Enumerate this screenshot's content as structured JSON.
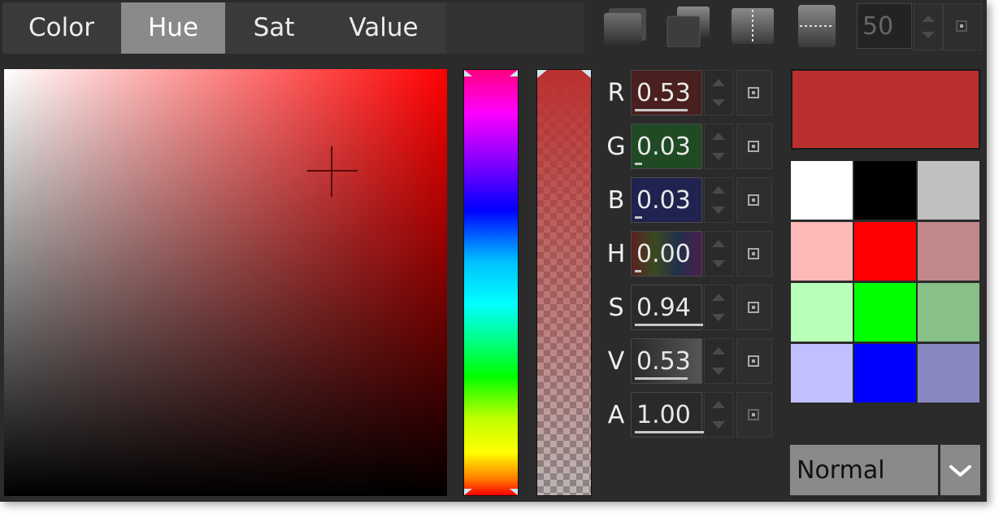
{
  "tabs": [
    {
      "label": "Color",
      "active": false
    },
    {
      "label": "Hue",
      "active": true
    },
    {
      "label": "Sat",
      "active": false
    },
    {
      "label": "Value",
      "active": false
    }
  ],
  "toolbar": {
    "icons": [
      "layer-stack-icon",
      "layer-offset-icon",
      "vertical-split-icon",
      "horizontal-split-icon"
    ],
    "number_value": "50"
  },
  "picker": {
    "hue_slider_value": 0.0,
    "saturation": 0.94,
    "value": 0.53,
    "alpha": 1.0
  },
  "channels": [
    {
      "letter": "R",
      "value": "0.53",
      "fraction": 0.53,
      "bg": "#4a1f1f"
    },
    {
      "letter": "G",
      "value": "0.03",
      "fraction": 0.03,
      "bg": "#1f4a24"
    },
    {
      "letter": "B",
      "value": "0.03",
      "fraction": 0.03,
      "bg": "#20224f"
    },
    {
      "letter": "H",
      "value": "0.00",
      "fraction": 0.0,
      "bg": "#3d2f2a"
    },
    {
      "letter": "S",
      "value": "0.94",
      "fraction": 0.94,
      "bg": "#2a2a2a"
    },
    {
      "letter": "V",
      "value": "0.53",
      "fraction": 0.53,
      "bg": "#3a3a3a"
    },
    {
      "letter": "A",
      "value": "1.00",
      "fraction": 1.0,
      "bg": "#2a2a2a"
    }
  ],
  "current_color": "#bb302f",
  "swatches": [
    "#ffffff",
    "#000000",
    "#c0c0c0",
    "#ffb8b8",
    "#ff0000",
    "#c08888",
    "#b8ffb8",
    "#00ff00",
    "#88c088",
    "#c0c0ff",
    "#0000ff",
    "#8888c0"
  ],
  "blend_mode": {
    "selected": "Normal"
  }
}
